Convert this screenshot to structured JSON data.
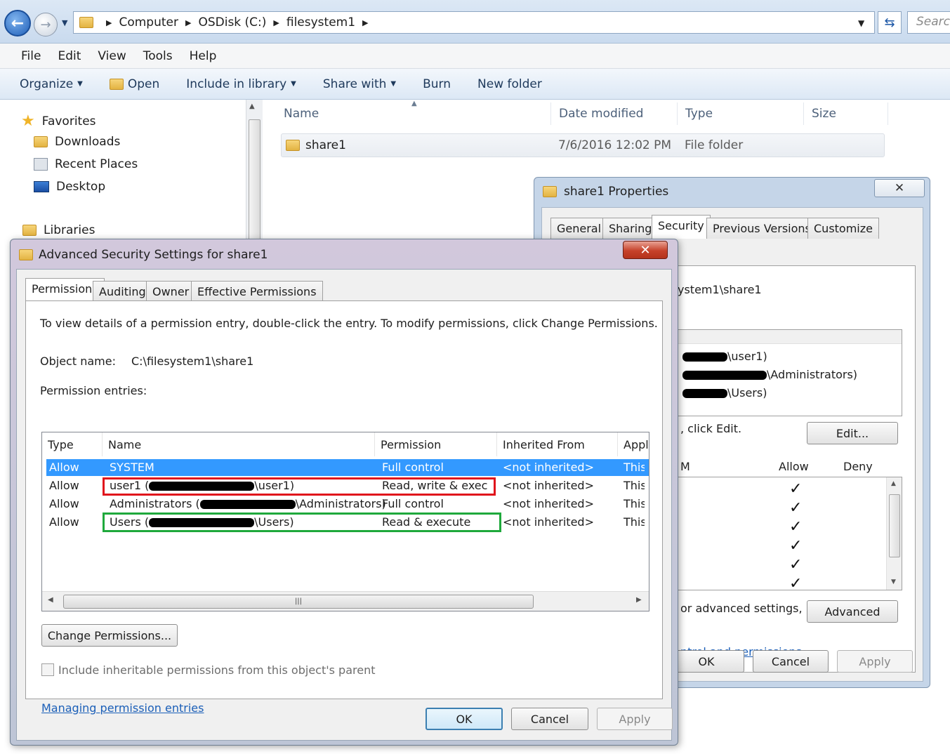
{
  "explorer": {
    "breadcrumb": [
      "Computer",
      "OSDisk (C:)",
      "filesystem1"
    ],
    "search_placeholder": "Search",
    "menu": [
      "File",
      "Edit",
      "View",
      "Tools",
      "Help"
    ],
    "commands": {
      "organize": "Organize",
      "open": "Open",
      "include": "Include in library",
      "share": "Share with",
      "burn": "Burn",
      "new_folder": "New folder"
    },
    "nav": {
      "favorites": "Favorites",
      "downloads": "Downloads",
      "recent": "Recent Places",
      "desktop": "Desktop",
      "libraries": "Libraries"
    },
    "columns": {
      "name": "Name",
      "date": "Date modified",
      "type": "Type",
      "size": "Size"
    },
    "files": [
      {
        "name": "share1",
        "date": "7/6/2016 12:02 PM",
        "type": "File folder"
      }
    ]
  },
  "props": {
    "title": "share1 Properties",
    "tabs": [
      "General",
      "Sharing",
      "Security",
      "Previous Versions",
      "Customize"
    ],
    "object_path_fragment": "ystem1\\share1",
    "group_fragments": [
      "\\user1)",
      "\\Administrators)",
      "\\Users)"
    ],
    "edit_hint_fragment": ", click Edit.",
    "edit_button": "Edit...",
    "perm_header_fragment": "M",
    "allow": "Allow",
    "deny": "Deny",
    "check_glyph": "✓",
    "advanced_hint_fragment": "or advanced settings,",
    "advanced_button": "Advanced",
    "link_fragment": "ntrol and permissions",
    "ok": "OK",
    "cancel": "Cancel",
    "apply": "Apply"
  },
  "advanced": {
    "title": "Advanced Security Settings for share1",
    "tabs": [
      "Permissions",
      "Auditing",
      "Owner",
      "Effective Permissions"
    ],
    "instructions": "To view details of a permission entry, double-click the entry. To modify permissions, click Change Permissions.",
    "object_name_label": "Object name:",
    "object_name_value": "C:\\filesystem1\\share1",
    "entries_label": "Permission entries:",
    "headers": [
      "Type",
      "Name",
      "Permission",
      "Inherited From",
      "Apply"
    ],
    "entries": [
      {
        "type": "Allow",
        "name_pre": "SYSTEM",
        "name_post": "",
        "permission": "Full control",
        "inherited": "<not inherited>",
        "apply": "This"
      },
      {
        "type": "Allow",
        "name_pre": "user1 (",
        "name_post": "\\user1)",
        "permission": "Read, write & exec...",
        "inherited": "<not inherited>",
        "apply": "This"
      },
      {
        "type": "Allow",
        "name_pre": "Administrators (",
        "name_post": "\\Administrators)",
        "permission": "Full control",
        "inherited": "<not inherited>",
        "apply": "This"
      },
      {
        "type": "Allow",
        "name_pre": "Users (",
        "name_post": "\\Users)",
        "permission": "Read & execute",
        "inherited": "<not inherited>",
        "apply": "This"
      }
    ],
    "change_button": "Change Permissions...",
    "include_checkbox": "Include inheritable permissions from this object's parent",
    "link": "Managing permission entries",
    "ok": "OK",
    "cancel": "Cancel",
    "apply": "Apply",
    "highlight_colors": {
      "red": "#e0141c",
      "green": "#1fa93c"
    }
  }
}
